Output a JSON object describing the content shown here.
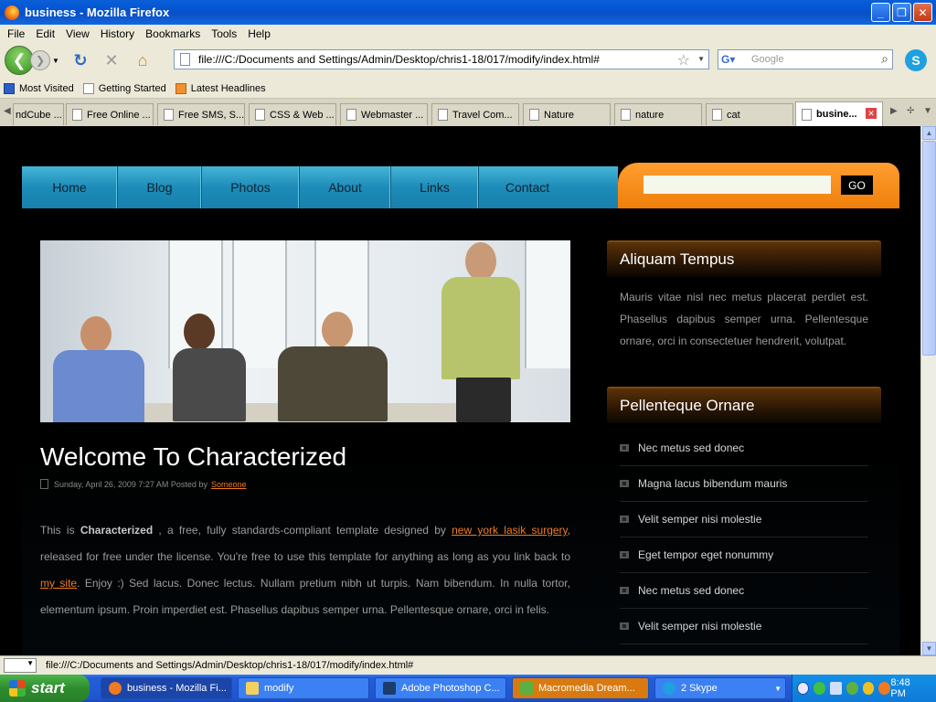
{
  "window": {
    "title": "business - Mozilla Firefox",
    "minimize_glyph": "_",
    "maximize_glyph": "❐",
    "close_glyph": "✕"
  },
  "menu": [
    "File",
    "Edit",
    "View",
    "History",
    "Bookmarks",
    "Tools",
    "Help"
  ],
  "toolbar": {
    "url": "file:///C:/Documents and Settings/Admin/Desktop/chris1-18/017/modify/index.html#",
    "search_placeholder": "Google",
    "back_glyph": "❮",
    "forward_glyph": "❯",
    "reload_glyph": "↻",
    "stop_glyph": "✕",
    "home_glyph": "⌂"
  },
  "bookmarks": [
    "Most Visited",
    "Getting Started",
    "Latest Headlines"
  ],
  "tabs": [
    "ndCube ...",
    "Free Online ...",
    "Free SMS, S...",
    "CSS & Web ...",
    "Webmaster ...",
    "Travel Com...",
    "Nature",
    "nature",
    "cat",
    "busine..."
  ],
  "site": {
    "nav": [
      "Home",
      "Blog",
      "Photos",
      "About",
      "Links",
      "Contact"
    ],
    "search_button": "GO",
    "post": {
      "title": "Welcome To Characterized",
      "meta_date": "Sunday, April 26, 2009 7:27 AM Posted by",
      "meta_author": "Someone",
      "p_intro": "This is ",
      "p_bold": "Characterized",
      "p_mid": " , a free, fully standards-compliant template designed by ",
      "p_link1": "new york lasik surgery",
      "p_after1": ", released for free under the license. You're free to use this template for anything as long as you link back to ",
      "p_link2": "my site",
      "p_after2": ". Enjoy :) Sed lacus. Donec lectus. Nullam pretium nibh ut turpis. Nam bibendum. In nulla tortor, elementum ipsum. Proin imperdiet est. Phasellus dapibus semper urna. Pellentesque ornare, orci in felis."
    },
    "sidebar": {
      "box1_title": "Aliquam Tempus",
      "box1_text": "Mauris vitae nisl nec metus placerat perdiet est. Phasellus dapibus semper urna. Pellentesque ornare, orci in consectetuer hendrerit, volutpat.",
      "box2_title": "Pellenteque Ornare",
      "box2_items": [
        "Nec metus sed donec",
        "Magna lacus bibendum mauris",
        "Velit semper nisi molestie",
        "Eget tempor eget nonummy",
        "Nec metus sed donec",
        "Velit semper nisi molestie"
      ]
    }
  },
  "status": {
    "text": "file:///C:/Documents and Settings/Admin/Desktop/chris1-18/017/modify/index.html#"
  },
  "taskbar": {
    "start": "start",
    "tasks": [
      "business - Mozilla Fi...",
      "modify",
      "Adobe Photoshop C...",
      "Macromedia Dream...",
      "2 Skype"
    ],
    "clock": "8:48 PM"
  }
}
